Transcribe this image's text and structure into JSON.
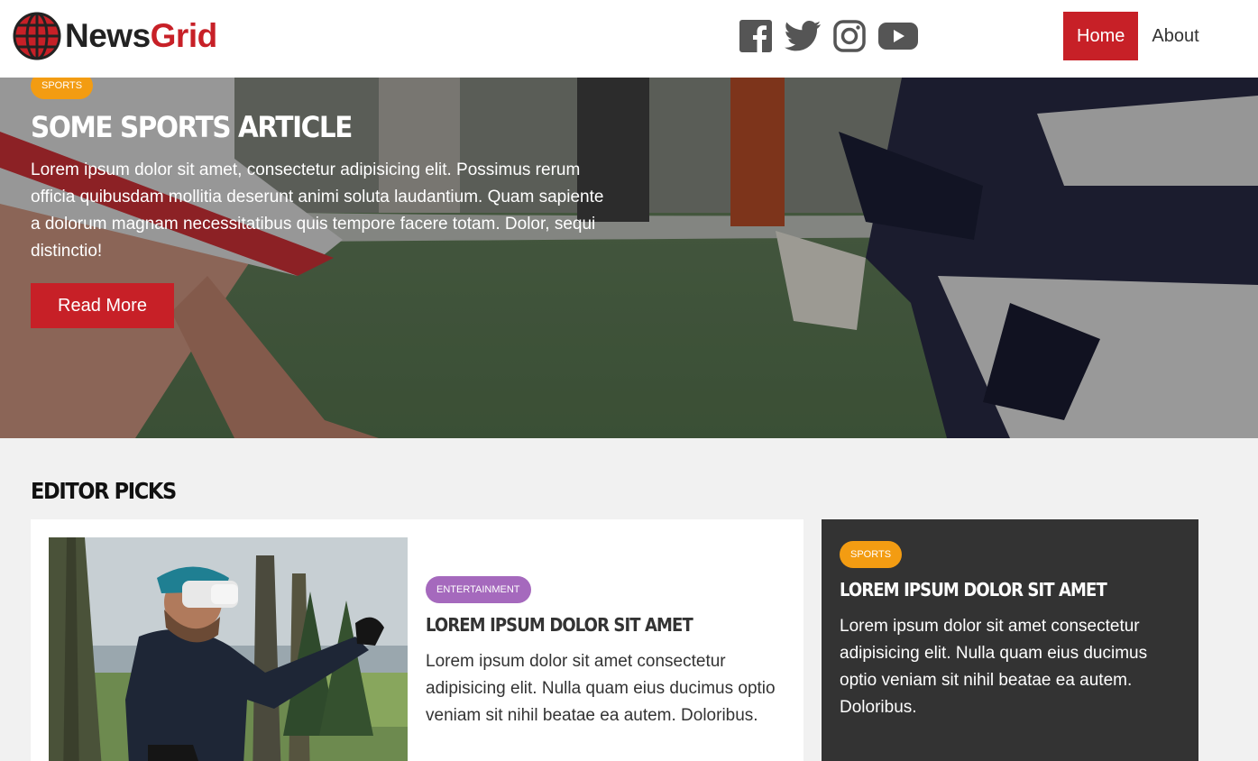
{
  "header": {
    "logo_part1": "News",
    "logo_part2": "Grid",
    "social_icons": [
      "facebook-icon",
      "twitter-icon",
      "instagram-icon",
      "youtube-icon"
    ],
    "nav": [
      {
        "label": "Home",
        "active": true
      },
      {
        "label": "About",
        "active": false
      }
    ]
  },
  "hero": {
    "category": "SPORTS",
    "title": "SOME SPORTS ARTICLE",
    "text": "Lorem ipsum dolor sit amet, consectetur adipisicing elit. Possimus rerum officia quibusdam mollitia deserunt animi soluta laudantium. Quam sapiente a dolorum magnam necessitatibus quis tempore facere totam. Dolor, sequi distinctio!",
    "button": "Read More"
  },
  "editor_picks": {
    "title": "EDITOR PICKS",
    "main_card": {
      "category": "ENTERTAINMENT",
      "title": "LOREM IPSUM DOLOR SIT AMET",
      "text": "Lorem ipsum dolor sit amet consectetur adipisicing elit. Nulla quam eius ducimus optio veniam sit nihil beatae ea autem. Doloribus."
    },
    "side_card": {
      "category": "SPORTS",
      "title": "LOREM IPSUM DOLOR SIT AMET",
      "text": "Lorem ipsum dolor sit amet consectetur adipisicing elit. Nulla quam eius ducimus optio veniam sit nihil beatae ea autem. Doloribus."
    }
  },
  "colors": {
    "brand_red": "#c72027",
    "sports": "#f39c12",
    "entertainment": "#a569bd",
    "dark_card": "#333333"
  }
}
